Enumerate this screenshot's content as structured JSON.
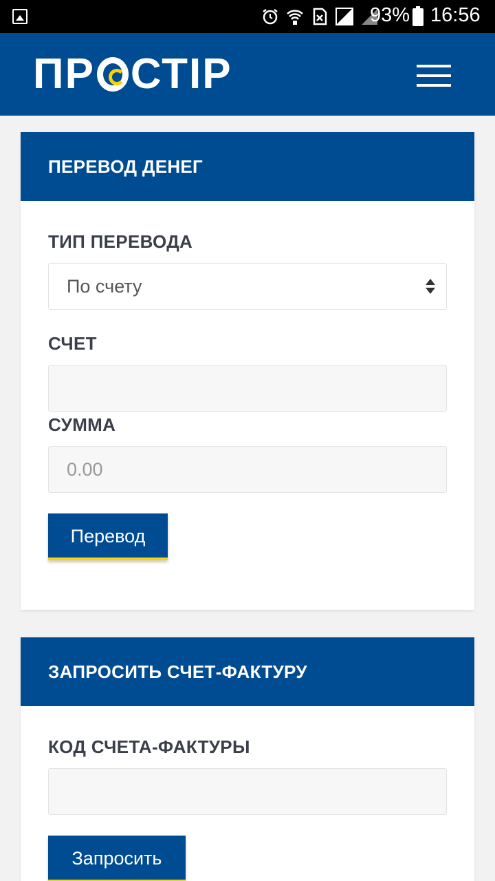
{
  "status_bar": {
    "battery_percent": "93%",
    "time": "16:56",
    "icons": [
      "gallery-icon",
      "alarm-icon",
      "wifi-icon",
      "sim-off-icon",
      "signal-icon",
      "signal-empty-icon",
      "battery-charging-icon"
    ]
  },
  "header": {
    "logo_text_left": "ПР",
    "logo_text_right": "СТІР",
    "menu_icon": "hamburger-menu-icon",
    "brand_color": "#004c93",
    "accent_color": "#ffd100"
  },
  "transfer_card": {
    "title": "ПЕРЕВОД ДЕНЕГ",
    "type_label": "ТИП ПЕРЕВОДА",
    "type_value": "По счету",
    "account_label": "СЧЕТ",
    "account_value": "",
    "amount_label": "СУММА",
    "amount_placeholder": "0.00",
    "submit_label": "Перевод"
  },
  "invoice_card": {
    "title": "ЗАПРОСИТЬ СЧЕТ-ФАКТУРУ",
    "code_label": "КОД СЧЕТА-ФАКТУРЫ",
    "code_value": "",
    "submit_label": "Запросить"
  }
}
